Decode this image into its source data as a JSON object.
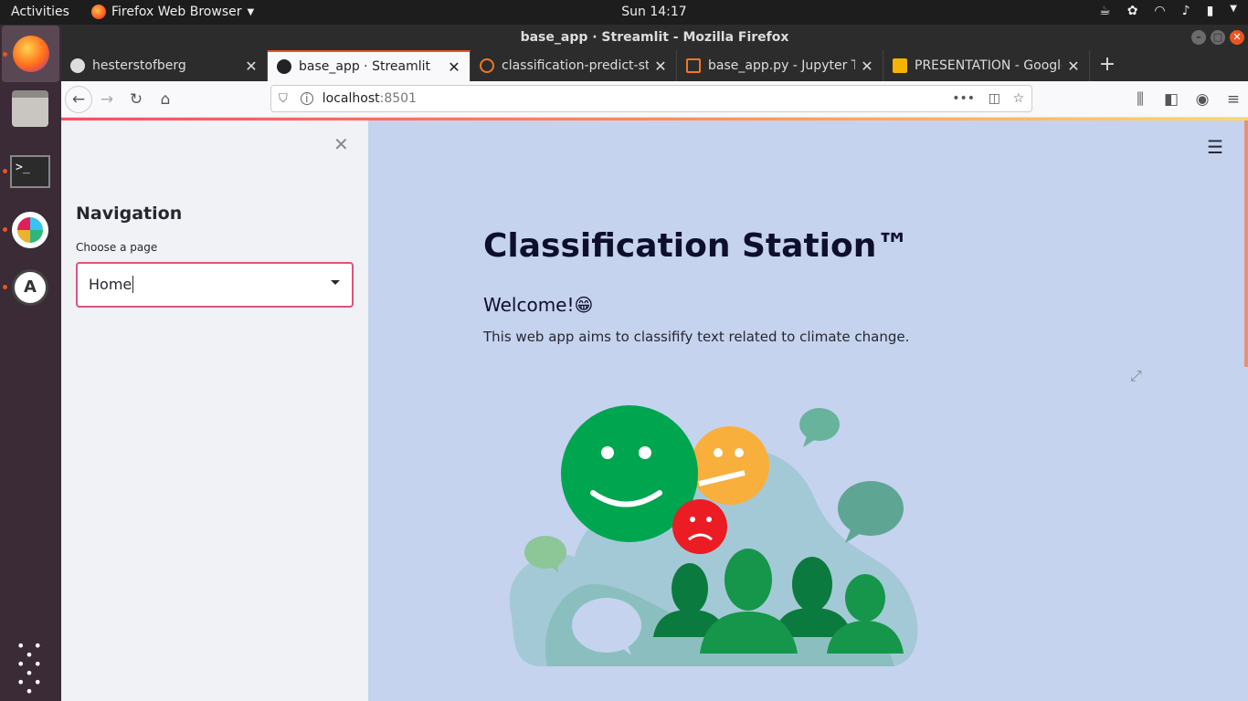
{
  "topbar": {
    "activities": "Activities",
    "app_name": "Firefox Web Browser",
    "clock": "Sun 14:17"
  },
  "window": {
    "title": "base_app · Streamlit - Mozilla Firefox"
  },
  "tabs": [
    {
      "label": "hesterstofberg",
      "icon": "github-icon"
    },
    {
      "label": "base_app · Streamlit",
      "icon": "streamlit-icon",
      "active": true
    },
    {
      "label": "classification-predict-stre",
      "icon": "jupyter-icon"
    },
    {
      "label": "base_app.py - Jupyter Te",
      "icon": "file-icon"
    },
    {
      "label": "PRESENTATION - Google",
      "icon": "slides-icon"
    }
  ],
  "url": {
    "host": "localhost",
    "port": ":8501"
  },
  "sidebar": {
    "heading": "Navigation",
    "select_label": "Choose a page",
    "select_value": "Home"
  },
  "main": {
    "title": "Classification Station™",
    "welcome": "Welcome!😁",
    "description": "This web app aims to classifify text related to climate change."
  },
  "colors": {
    "accent": "#e95420",
    "main_bg": "#c5d3ef",
    "sidebar_bg": "#f0f2f6",
    "select_border": "#e0527a",
    "green_face": "#00a550",
    "orange_face": "#f8af3c",
    "red_face": "#ec1c24"
  }
}
